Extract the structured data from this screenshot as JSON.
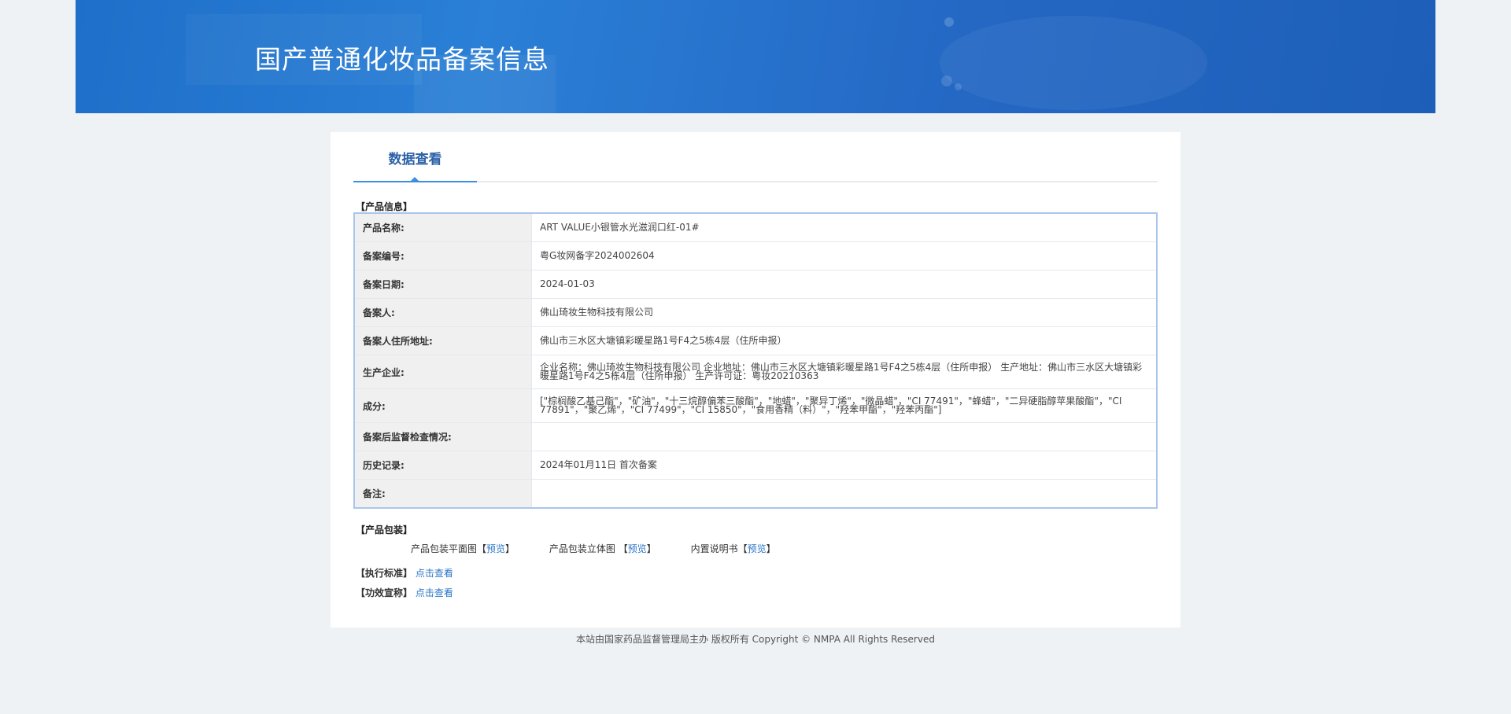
{
  "header": {
    "title": "国产普通化妆品备案信息"
  },
  "tabs": [
    {
      "label": "数据查看"
    }
  ],
  "product_info": {
    "section_title": "【产品信息】",
    "rows": [
      {
        "label": "产品名称:",
        "value": "ART VALUE小银管水光滋润口红-01#"
      },
      {
        "label": "备案编号:",
        "value": "粤G妆网备字2024002604"
      },
      {
        "label": "备案日期:",
        "value": "2024-01-03"
      },
      {
        "label": "备案人:",
        "value": "佛山琦妆生物科技有限公司"
      },
      {
        "label": "备案人住所地址:",
        "value": "佛山市三水区大塘镇彩暖星路1号F4之5栋4层（住所申报）"
      },
      {
        "label": "生产企业:",
        "value": "企业名称：佛山琦妆生物科技有限公司 企业地址：佛山市三水区大塘镇彩暖星路1号F4之5栋4层（住所申报） 生产地址：佛山市三水区大塘镇彩暖星路1号F4之5栋4层（住所申报） 生产许可证：粤妆20210363"
      },
      {
        "label": "成分:",
        "value": "[\"棕榈酸乙基己酯\"，\"矿油\"，\"十三烷醇偏苯三酸酯\"，\"地蜡\"，\"聚异丁烯\"，\"微晶蜡\"，\"CI 77491\"，\"蜂蜡\"，\"二异硬脂醇苹果酸酯\"，\"CI 77891\"，\"聚乙烯\"，\"CI 77499\"，\"CI 15850\"，\"食用香精（料）\"，\"羟苯甲酯\"，\"羟苯丙酯\"]"
      },
      {
        "label": "备案后监督检查情况:",
        "value": ""
      },
      {
        "label": "历史记录:",
        "value": "2024年01月11日 首次备案"
      },
      {
        "label": "备注:",
        "value": ""
      }
    ]
  },
  "packaging": {
    "section_title": "【产品包装】",
    "items": [
      {
        "label": "产品包装平面图",
        "link": "预览"
      },
      {
        "label": "产品包装立体图 ",
        "link": "预览"
      },
      {
        "label": "内置说明书",
        "link": "预览"
      }
    ]
  },
  "standard": {
    "label": "【执行标准】",
    "link": "点击查看"
  },
  "efficacy": {
    "label": "【功效宣称】",
    "link": "点击查看"
  },
  "footer": {
    "text": "本站由国家药品监督管理局主办 版权所有 Copyright © NMPA All Rights Reserved"
  },
  "colors": {
    "accent": "#3c8fe0",
    "link": "#2c77c7",
    "banner": "#2468c4"
  }
}
